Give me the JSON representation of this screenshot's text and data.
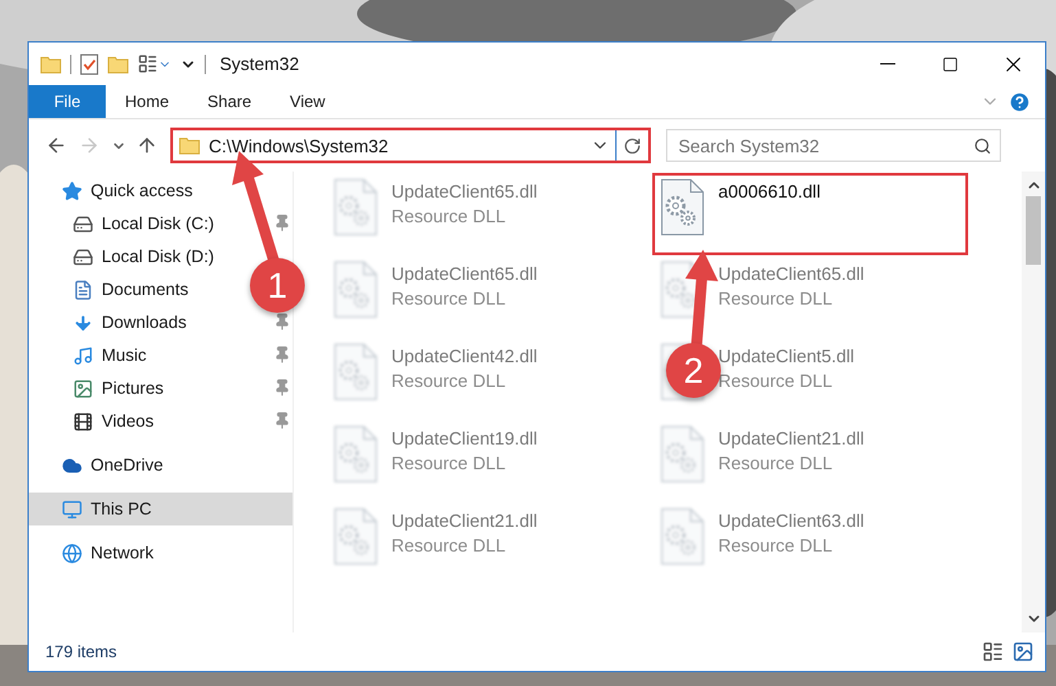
{
  "window": {
    "title": "System32"
  },
  "ribbon": {
    "tabs": [
      {
        "label": "File",
        "kind": "file"
      },
      {
        "label": "Home",
        "kind": "tab"
      },
      {
        "label": "Share",
        "kind": "tab"
      },
      {
        "label": "View",
        "kind": "tab"
      }
    ]
  },
  "address": {
    "path": "C:\\Windows\\System32",
    "highlighted": true
  },
  "search": {
    "placeholder": "Search System32"
  },
  "sidebar": {
    "items": [
      {
        "label": "Quick access",
        "kind": "star",
        "selected": false,
        "children": [
          {
            "label": "Local Disk (C:)",
            "kind": "system-drive",
            "selected": false,
            "pinned": true
          },
          {
            "label": "Local Disk (D:)",
            "kind": "drive",
            "selected": false,
            "pinned": false
          },
          {
            "label": "Documents",
            "kind": "documents",
            "selected": false,
            "pinned": false
          },
          {
            "label": "Downloads",
            "kind": "downloads",
            "selected": false,
            "pinned": true
          },
          {
            "label": "Music",
            "kind": "music",
            "selected": false,
            "pinned": true
          },
          {
            "label": "Pictures",
            "kind": "pictures",
            "selected": false,
            "pinned": true
          },
          {
            "label": "Videos",
            "kind": "videos",
            "selected": false,
            "pinned": true
          }
        ]
      },
      {
        "label": "OneDrive",
        "kind": "cloud",
        "selected": false
      },
      {
        "label": "This PC",
        "kind": "pc",
        "selected": true
      },
      {
        "label": "Network",
        "kind": "network",
        "selected": false
      }
    ]
  },
  "files": [
    {
      "name": "UpdateClient65.dll",
      "type": "Resource DLL",
      "blurred": true,
      "highlighted": false
    },
    {
      "name": "a0006610.dll",
      "blurred": false,
      "highlighted": true
    },
    {
      "name": "UpdateClient65.dll",
      "type": "Resource DLL",
      "blurred": true,
      "highlighted": false
    },
    {
      "name": "UpdateClient65.dll",
      "type": "Resource DLL",
      "blurred": true,
      "highlighted": false
    },
    {
      "name": "UpdateClient42.dll",
      "type": "Resource DLL",
      "blurred": true,
      "highlighted": false
    },
    {
      "name": "UpdateClient5.dll",
      "type": "Resource DLL",
      "blurred": true,
      "highlighted": false
    },
    {
      "name": "UpdateClient19.dll",
      "type": "Resource DLL",
      "blurred": true,
      "highlighted": false
    },
    {
      "name": "UpdateClient21.dll",
      "type": "Resource DLL",
      "blurred": true,
      "highlighted": false
    },
    {
      "name": "UpdateClient21.dll",
      "type": "Resource DLL",
      "blurred": true,
      "highlighted": false
    },
    {
      "name": "UpdateClient63.dll",
      "type": "Resource DLL",
      "blurred": true,
      "highlighted": false
    }
  ],
  "annotations": [
    {
      "label": "1"
    },
    {
      "label": "2"
    }
  ],
  "status_bar": {
    "count": "179 items"
  }
}
